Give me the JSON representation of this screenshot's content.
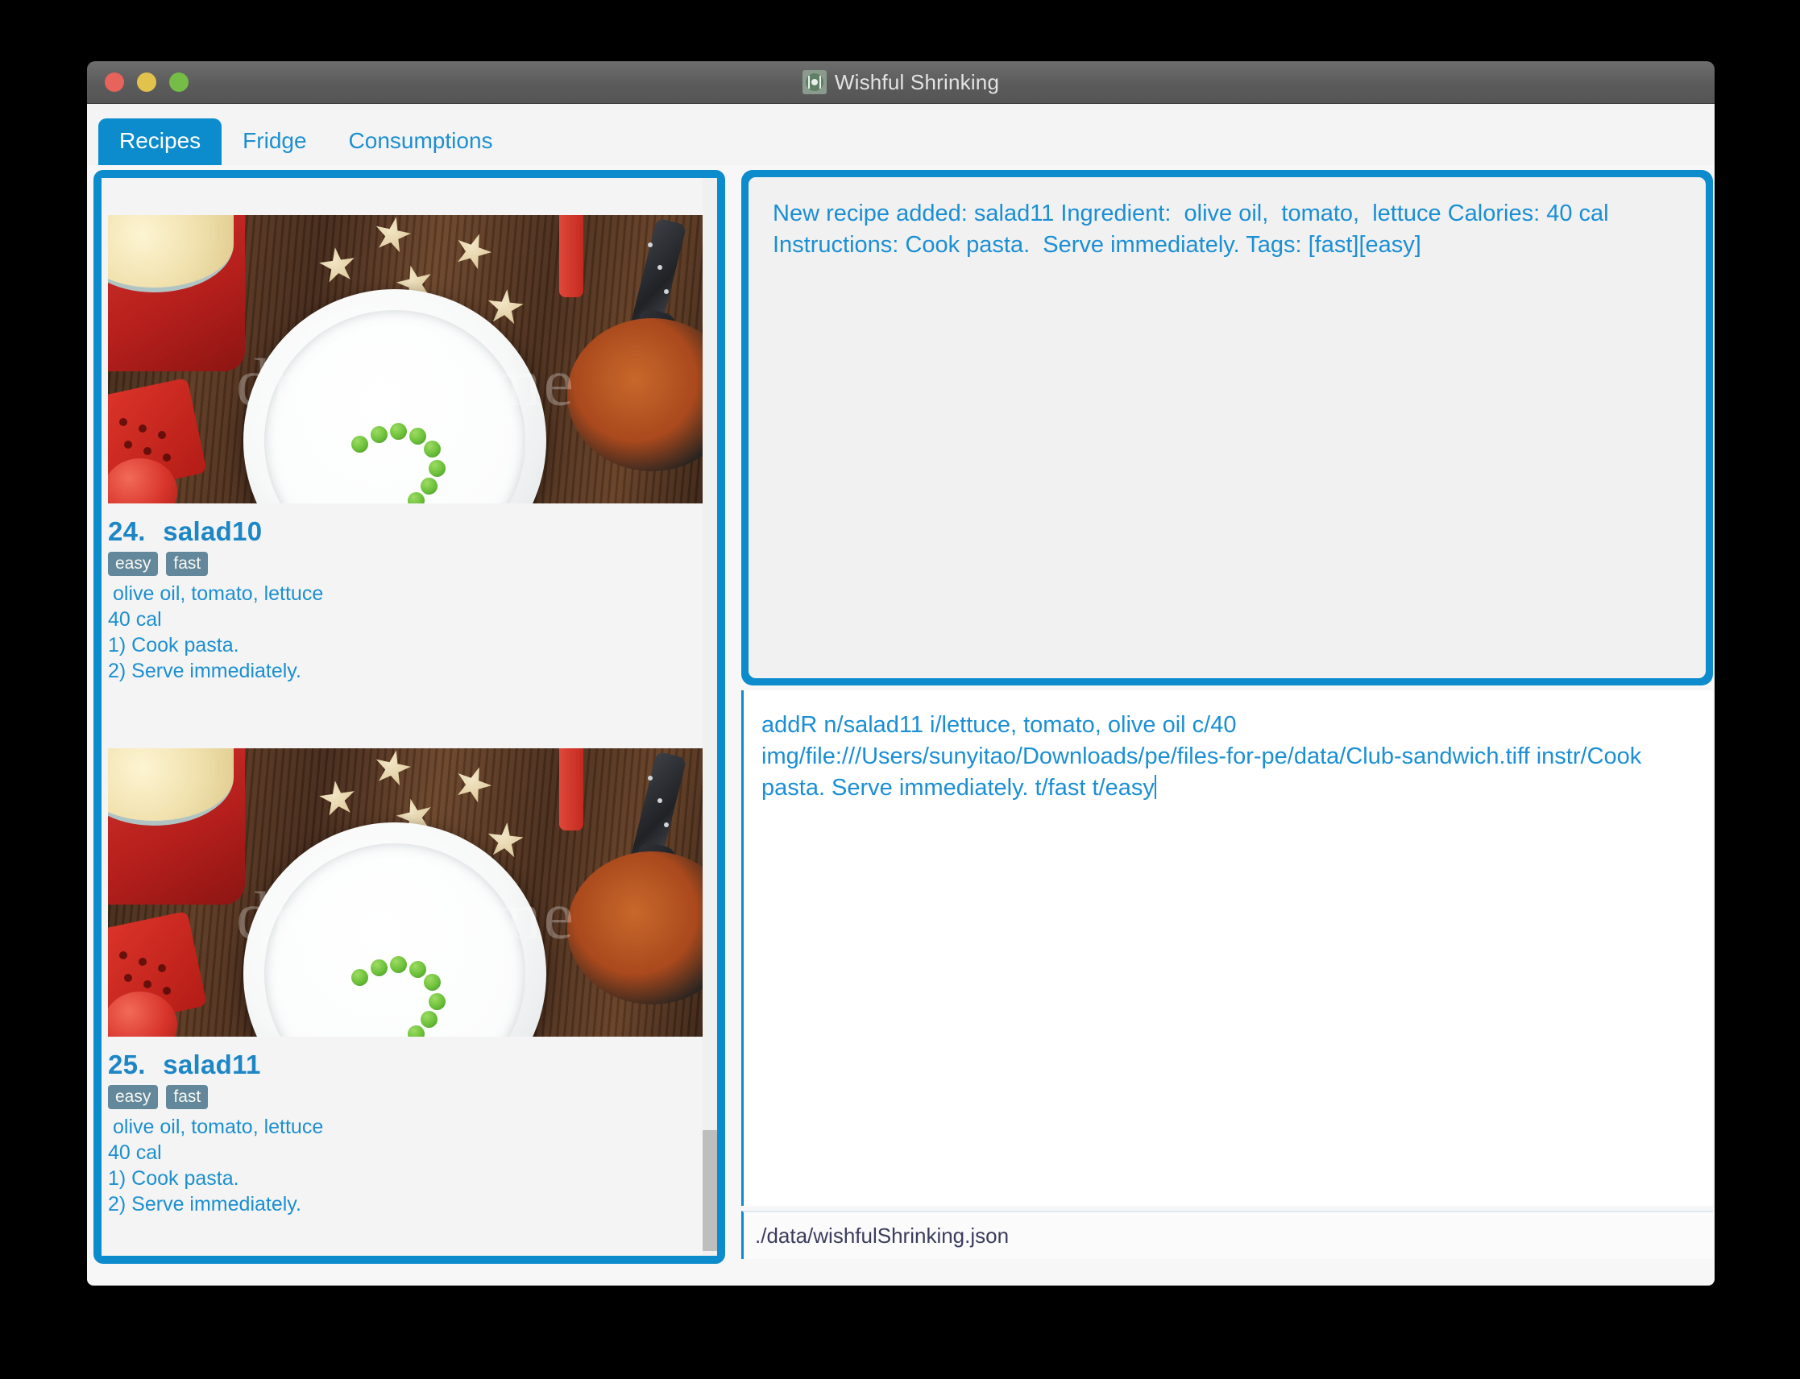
{
  "window": {
    "title": "Wishful Shrinking",
    "icon": "plate-fork-knife-icon",
    "controls": {
      "close": "close-button",
      "minimize": "minimize-button",
      "zoom": "zoom-button"
    }
  },
  "tabs": [
    {
      "label": "Recipes",
      "active": true
    },
    {
      "label": "Fridge",
      "active": false
    },
    {
      "label": "Consumptions",
      "active": false
    }
  ],
  "recipes": [
    {
      "index": "24.",
      "name": "salad10",
      "tags": [
        "easy",
        "fast"
      ],
      "ingredients": " olive oil,  tomato,  lettuce",
      "calories": "40 cal",
      "steps": [
        "1) Cook pasta.",
        "2) Serve immediately."
      ],
      "image_watermark": "dreamstime"
    },
    {
      "index": "25.",
      "name": "salad11",
      "tags": [
        "easy",
        "fast"
      ],
      "ingredients": " olive oil,  tomato,  lettuce",
      "calories": "40 cal",
      "steps": [
        "1) Cook pasta.",
        "2) Serve immediately."
      ],
      "image_watermark": "dreamstime"
    }
  ],
  "message_panel": {
    "text": "New recipe added: salad11 Ingredient:  olive oil,  tomato,  lettuce Calories: 40 cal Instructions: Cook pasta.  Serve immediately. Tags: [fast][easy]"
  },
  "command_box": {
    "text": "addR n/salad11 i/lettuce, tomato, olive oil c/40 img/file:///Users/sunyitao/Downloads/pe/files-for-pe/data/Club-sandwich.tiff instr/Cook pasta. Serve immediately. t/fast t/easy"
  },
  "status_bar": {
    "path": "./data/wishfulShrinking.json"
  },
  "colors": {
    "accent": "#0d8ccd",
    "text_blue": "#1b8fd4",
    "tag_bg": "#63889b",
    "status_text": "#3c3c5e",
    "titlebar": "#5b5b5b",
    "panel_bg": "#f1f1f1"
  }
}
